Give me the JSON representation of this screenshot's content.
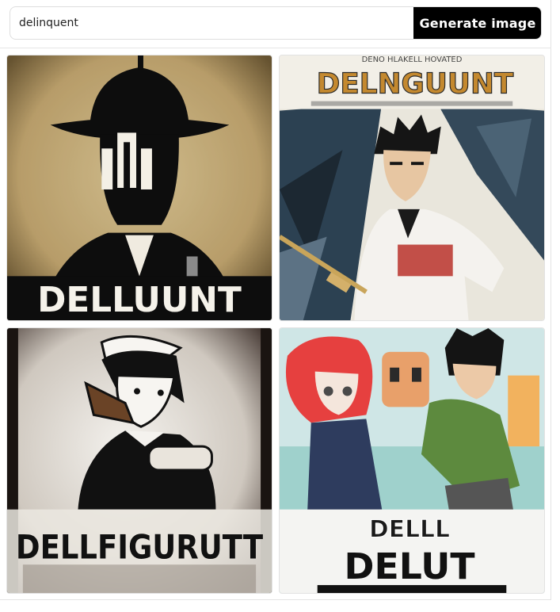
{
  "search": {
    "value": "delinquent"
  },
  "generate_button": {
    "label": "Generate image"
  },
  "images": [
    {
      "poster_text": "DELLUUNT",
      "subtitle": ""
    },
    {
      "poster_text": "DELNGUUNT",
      "subtitle": "DENO HLAKELL HOVATED"
    },
    {
      "poster_text": "DELLFIGURUTT",
      "subtitle": ""
    },
    {
      "poster_text": "DELUT",
      "subtitle": "DELLL"
    }
  ],
  "colors": {
    "button_bg": "#000000",
    "button_text": "#ffffff",
    "border": "#dedede"
  }
}
